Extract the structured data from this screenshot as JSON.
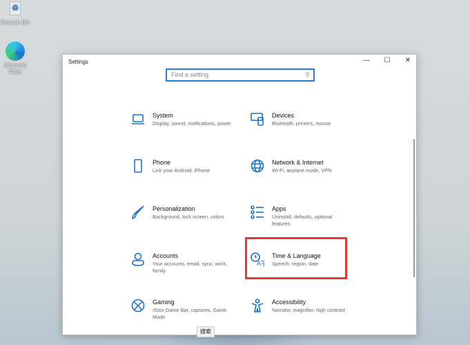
{
  "desktop": {
    "icons": [
      {
        "label": "Recycle Bin"
      },
      {
        "label": "Microsoft Edge"
      }
    ]
  },
  "window": {
    "title": "Settings",
    "controls": {
      "minimize": "—",
      "maximize": "☐",
      "close": "✕"
    }
  },
  "search": {
    "placeholder": "Find a setting",
    "icon": "search-icon"
  },
  "items": [
    {
      "name": "System",
      "desc": "Display, sound, notifications, power"
    },
    {
      "name": "Devices",
      "desc": "Bluetooth, printers, mouse"
    },
    {
      "name": "Phone",
      "desc": "Link your Android, iPhone"
    },
    {
      "name": "Network & Internet",
      "desc": "Wi-Fi, airplane mode, VPN"
    },
    {
      "name": "Personalization",
      "desc": "Background, lock screen, colors"
    },
    {
      "name": "Apps",
      "desc": "Uninstall, defaults, optional features"
    },
    {
      "name": "Accounts",
      "desc": "Your accounts, email, sync, work, family"
    },
    {
      "name": "Time & Language",
      "desc": "Speech, region, date"
    },
    {
      "name": "Gaming",
      "desc": "Xbox Game Bar, captures, Game Mode"
    },
    {
      "name": "Accessibility",
      "desc": "Narrator, magnifier, high contrast"
    }
  ],
  "tooltip": "搜索",
  "accent": "#1a73c7",
  "highlight": "#e53935"
}
